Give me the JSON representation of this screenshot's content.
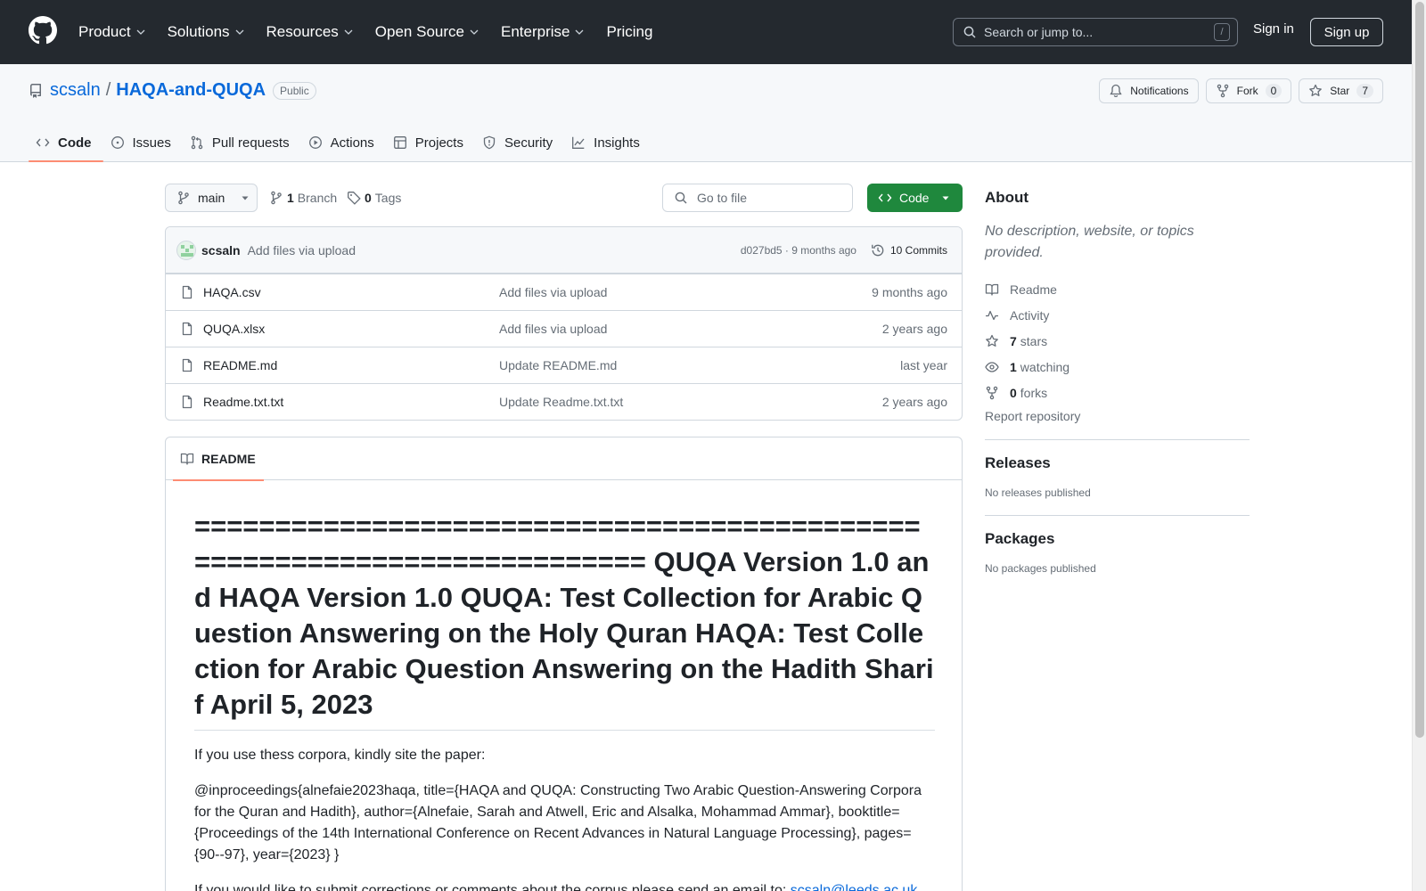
{
  "header": {
    "nav": [
      "Product",
      "Solutions",
      "Resources",
      "Open Source",
      "Enterprise",
      "Pricing"
    ],
    "nav_has_dropdown": [
      true,
      true,
      true,
      true,
      true,
      false
    ],
    "search_placeholder": "Search or jump to...",
    "search_key": "/",
    "sign_in": "Sign in",
    "sign_up": "Sign up"
  },
  "repo": {
    "owner": "scsaln",
    "separator": "/",
    "name": "HAQA-and-QUQA",
    "visibility": "Public",
    "actions": {
      "notifications": "Notifications",
      "fork": "Fork",
      "fork_count": "0",
      "star": "Star",
      "star_count": "7"
    },
    "tabs": [
      {
        "label": "Code",
        "icon": "code-icon",
        "active": true
      },
      {
        "label": "Issues",
        "icon": "issue-icon",
        "active": false
      },
      {
        "label": "Pull requests",
        "icon": "pull-request-icon",
        "active": false
      },
      {
        "label": "Actions",
        "icon": "play-icon",
        "active": false
      },
      {
        "label": "Projects",
        "icon": "table-icon",
        "active": false
      },
      {
        "label": "Security",
        "icon": "shield-icon",
        "active": false
      },
      {
        "label": "Insights",
        "icon": "graph-icon",
        "active": false
      }
    ]
  },
  "toolbar": {
    "branch": "main",
    "branch_count": "1",
    "branch_label": "Branch",
    "tag_count": "0",
    "tag_label": "Tags",
    "goto_placeholder": "Go to file",
    "code_label": "Code"
  },
  "commit": {
    "author": "scsaln",
    "message": "Add files via upload",
    "hash_time": "d027bd5 · 9 months ago",
    "commits": "10 Commits"
  },
  "files": [
    {
      "name": "HAQA.csv",
      "message": "Add files via upload",
      "date": "9 months ago"
    },
    {
      "name": "QUQA.xlsx",
      "message": "Add files via upload",
      "date": "2 years ago"
    },
    {
      "name": "README.md",
      "message": "Update README.md",
      "date": "last year"
    },
    {
      "name": "Readme.txt.txt",
      "message": "Update Readme.txt.txt",
      "date": "2 years ago"
    }
  ],
  "readme": {
    "tab": "README",
    "heading": "========================================================================= QUQA Version 1.0 and HAQA Version 1.0 QUQA: Test Collection for Arabic Question Answering on the Holy Quran HAQA: Test Collection for Arabic Question Answering on the Hadith Sharif April 5, 2023",
    "p1": "If you use thess corpora, kindly site the paper:",
    "p2": "@inproceedings{alnefaie2023haqa, title={HAQA and QUQA: Constructing Two Arabic Question-Answering Corpora for the Quran and Hadith}, author={Alnefaie, Sarah and Atwell, Eric and Alsalka, Mohammad Ammar}, booktitle={Proceedings of the 14th International Conference on Recent Advances in Natural Language Processing}, pages={90--97}, year={2023} }",
    "p3_text": "If you would like to submit corrections or comments about the corpus please send an email to: ",
    "p3_link": "scsaln@leeds.ac.uk"
  },
  "sidebar": {
    "about_title": "About",
    "about_desc": "No description, website, or topics provided.",
    "readme": "Readme",
    "activity": "Activity",
    "stars_count": "7",
    "stars_label": "stars",
    "watching_count": "1",
    "watching_label": "watching",
    "forks_count": "0",
    "forks_label": "forks",
    "report": "Report repository",
    "releases_title": "Releases",
    "releases_empty": "No releases published",
    "packages_title": "Packages",
    "packages_empty": "No packages published"
  },
  "colors": {
    "header_bg": "#24292f",
    "link": "#0969da",
    "primary_button": "#1f883d",
    "tab_underline": "#fd8c73"
  }
}
